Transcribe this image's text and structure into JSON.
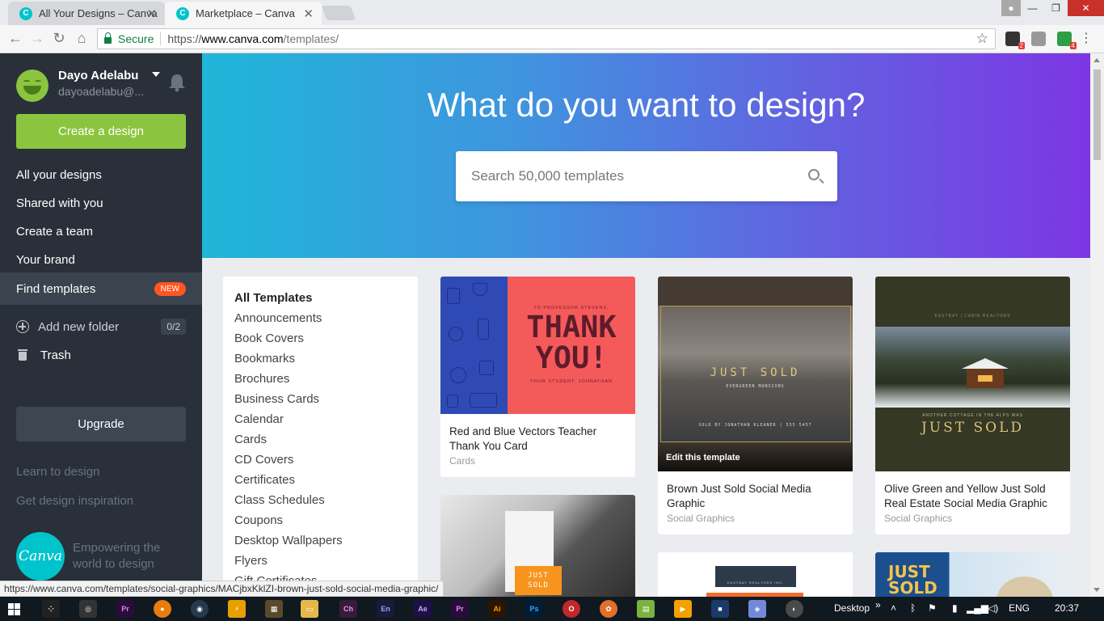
{
  "browser": {
    "tabs": [
      {
        "title": "All Your Designs – Canva",
        "active": false
      },
      {
        "title": "Marketplace – Canva",
        "active": true
      }
    ],
    "secure_label": "Secure",
    "url_proto": "https://",
    "url_host": "www.canva.com",
    "url_path": "/templates/",
    "favicon_letter": "C",
    "extension_badges": [
      "2",
      "4"
    ]
  },
  "sidebar": {
    "user_name": "Dayo Adelabu",
    "user_email": "dayoadelabu@...",
    "create_label": "Create a design",
    "nav": [
      {
        "label": "All your designs"
      },
      {
        "label": "Shared with you"
      },
      {
        "label": "Create a team"
      },
      {
        "label": "Your brand"
      },
      {
        "label": "Find templates",
        "badge": "NEW"
      }
    ],
    "add_folder_label": "Add new folder",
    "folder_count": "0/2",
    "trash_label": "Trash",
    "upgrade_label": "Upgrade",
    "links": [
      "Learn to design",
      "Get design inspiration"
    ],
    "logo_text": "Canva",
    "tagline_1": "Empowering the",
    "tagline_2": "world to design"
  },
  "hero": {
    "title": "What do you want to design?",
    "search_placeholder": "Search 50,000 templates"
  },
  "categories": [
    "All Templates",
    "Announcements",
    "Book Covers",
    "Bookmarks",
    "Brochures",
    "Business Cards",
    "Calendar",
    "Cards",
    "CD Covers",
    "Certificates",
    "Class Schedules",
    "Coupons",
    "Desktop Wallpapers",
    "Flyers",
    "Gift Certificates"
  ],
  "templates": [
    {
      "title": "Red and Blue Vectors Teacher Thank You Card",
      "category": "Cards",
      "art_top": "TO PROFESSOR STEVENS,",
      "art_line1": "THANK",
      "art_line2": "YOU!",
      "art_bottom": "YOUR STUDENT, JOHNATHAN"
    },
    {
      "title": "Brown Just Sold Social Media Graphic",
      "category": "Social Graphics",
      "overlay": "Edit this template",
      "art_head": "JUST SOLD",
      "art_sub": "EVERGREEN MANSIONS",
      "art_foot": "SOLD BY JONATHAN KLEANER | 555 5457"
    },
    {
      "title": "Olive Green and Yellow Just Sold Real Estate Social Media Graphic",
      "category": "Social Graphics",
      "art_top": "EASTBAY | CABIN REALTORS",
      "art_sub": "ANOTHER COTTAGE IN THE ALPS WAS",
      "art_head": "JUST SOLD"
    },
    {
      "art_head": "JUST",
      "art_head2": "SOLD"
    },
    {
      "art_top": "EASTBAY REALTORS INC."
    },
    {
      "art_head": "JUST",
      "art_head2": "SOLD"
    }
  ],
  "status_url": "https://www.canva.com/templates/social-graphics/MACjbxKklZI-brown-just-sold-social-media-graphic/",
  "taskbar": {
    "desktop_label": "Desktop",
    "lang": "ENG",
    "time": "20:37",
    "apps": [
      "Pr",
      "Ch",
      "En",
      "Ae",
      "Pr",
      "Ai",
      "Ps"
    ]
  }
}
